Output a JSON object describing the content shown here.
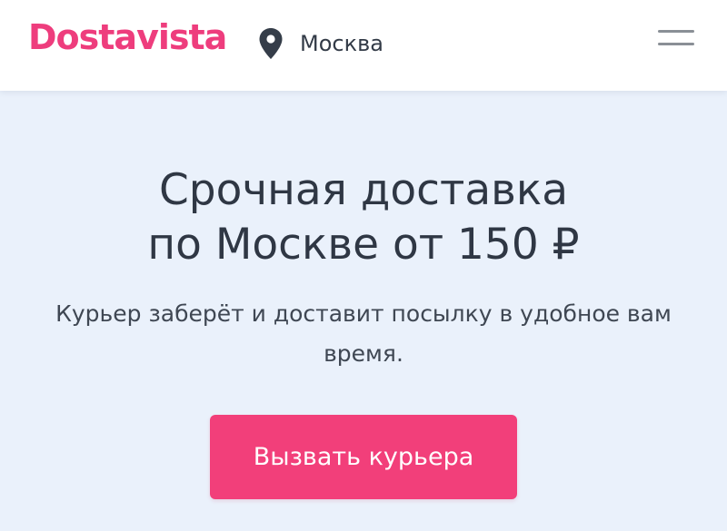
{
  "header": {
    "logo_text": "Dostavista",
    "city": "Москва",
    "location_icon": "map-pin-icon",
    "menu_icon": "hamburger-menu-icon"
  },
  "hero": {
    "headline_line1": "Срочная доставка",
    "headline_line2": "по Москве от 150 ₽",
    "subtitle": "Курьер заберёт и доставит посылку в удобное вам время.",
    "cta_label": "Вызвать курьера"
  },
  "colors": {
    "brand": "#ee3d7d",
    "button": "#f23f7a",
    "background": "#eaf1fb",
    "text": "#2f3744"
  }
}
